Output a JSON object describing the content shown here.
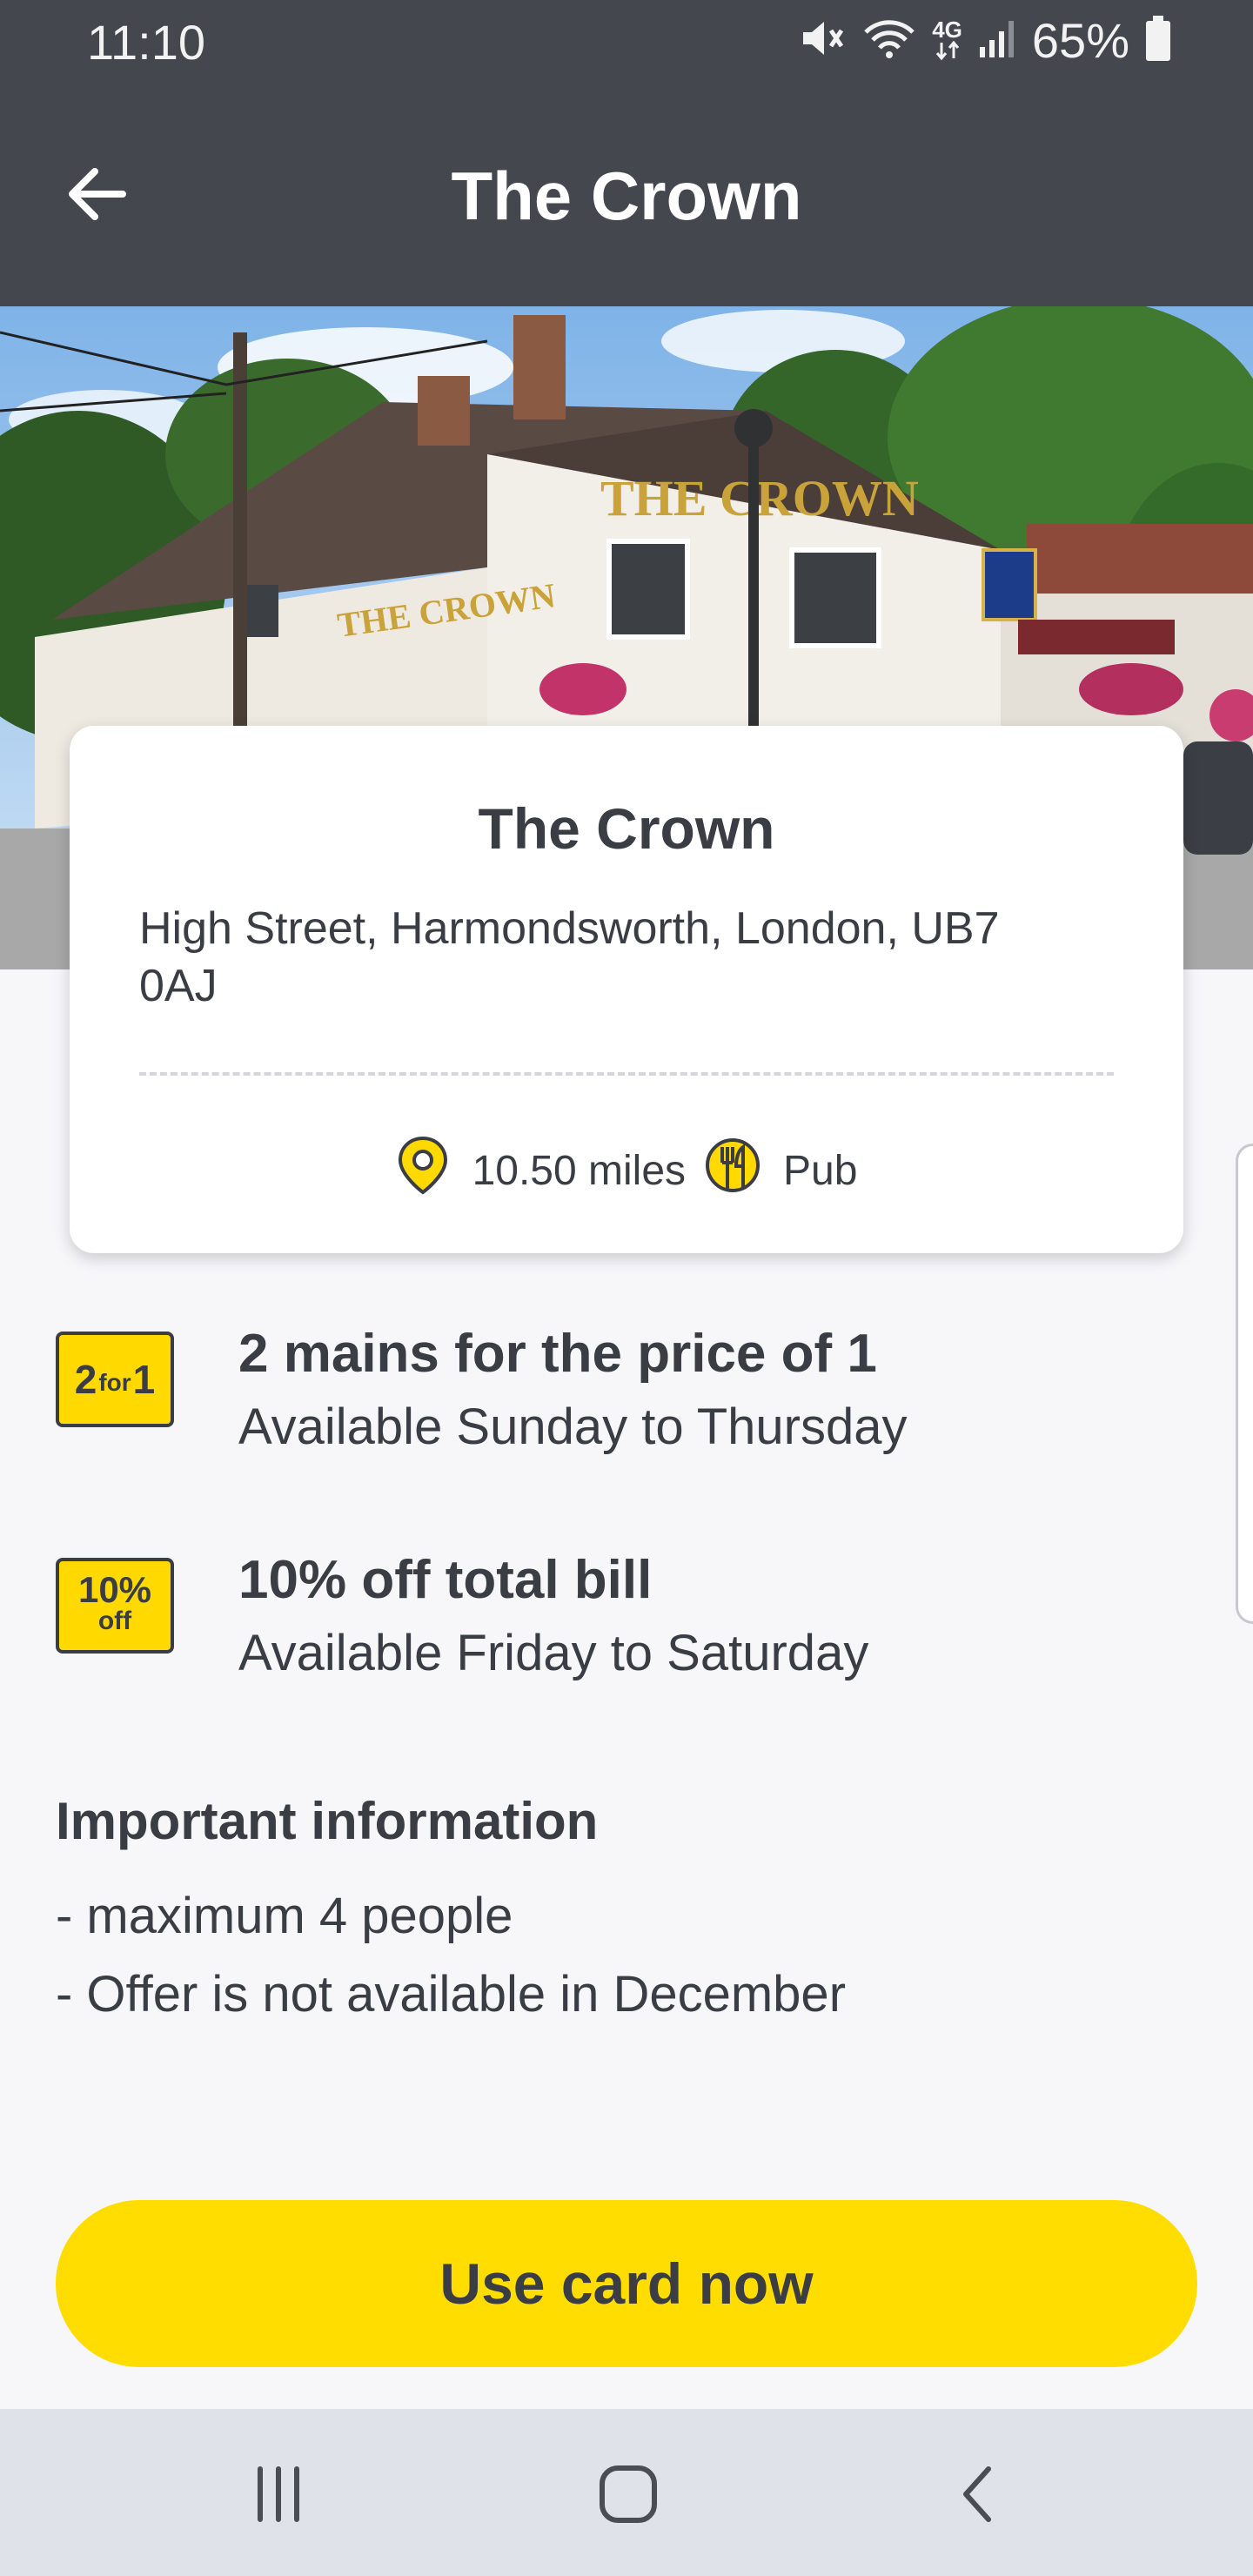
{
  "status_bar": {
    "time": "11:10",
    "network_label": "4G",
    "battery_percent": "65%"
  },
  "app_bar": {
    "title": "The Crown",
    "back_icon": "arrow-left-icon"
  },
  "hero": {
    "sign_main": "THE CROWN",
    "sign_side": "THE CROWN"
  },
  "venue": {
    "name": "The Crown",
    "address": "High Street, Harmondsworth, London, UB7 0AJ",
    "distance": "10.50 miles",
    "category": "Pub",
    "distance_icon": "location-pin-icon",
    "category_icon": "cutlery-icon"
  },
  "offers": [
    {
      "badge_main": "2",
      "badge_small": "for",
      "badge_end": "1",
      "title": "2 mains for the price of 1",
      "availability": "Available Sunday to Thursday"
    },
    {
      "badge_main": "10%",
      "badge_small": "off",
      "title": "10% off total bill",
      "availability": "Available Friday to Saturday"
    }
  ],
  "important": {
    "heading": "Important information",
    "lines": [
      "- maximum 4 people",
      "- Offer is not available in December"
    ]
  },
  "cta_label": "Use card now",
  "nav": {
    "recents_icon": "recents-icon",
    "home_icon": "home-icon",
    "back_icon": "chevron-left-icon"
  },
  "colors": {
    "topbar": "#44474d",
    "accent": "#ffdd00",
    "text": "#3a3d44",
    "background": "#f7f7fa"
  }
}
